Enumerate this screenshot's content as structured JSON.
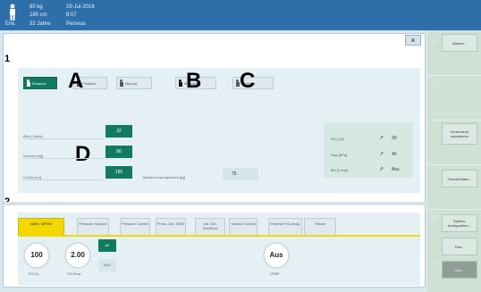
{
  "topbar": {
    "weight": "80 kg",
    "height": "185 cm",
    "category": "Erw.",
    "age": "32 Jahre",
    "date": "29-Jul-2016",
    "time": "8:07",
    "name": "Perseus"
  },
  "dialog": {
    "close_label": "×"
  },
  "section_numbers": [
    "1",
    "2"
  ],
  "annotations": {
    "A": "A",
    "B": "B",
    "C": "C",
    "D": "D"
  },
  "patient_types": [
    {
      "label": "Erwachs.",
      "active": true
    },
    {
      "label": "Pädiatrie",
      "active": false
    },
    {
      "label": "Neonat",
      "active": false
    },
    {
      "label": "Männlich",
      "active": false
    },
    {
      "label": "Weiblich",
      "active": false
    }
  ],
  "fields": {
    "age_label": "Alter [Jahre]",
    "age_value": "32",
    "weight_label": "Gewicht [kg]",
    "weight_value": "80",
    "height_label": "Größe [cm]",
    "height_value": "185",
    "ideal_label": "Ideales Körpergewicht [kg]",
    "ideal_value": "75"
  },
  "settings": [
    {
      "label": "FiO₂ [%]",
      "icon": "trend-up-icon",
      "value": "20"
    },
    {
      "label": "Paw [hPa]",
      "icon": "trend-up-icon",
      "value": "40"
    },
    {
      "label": "MV [L/min]",
      "icon": "trend-up-icon",
      "value": "Aus"
    }
  ],
  "mode_tabs": [
    {
      "label": "MAN / SPON",
      "active": true
    },
    {
      "label": "Pressure Support",
      "active": false
    },
    {
      "label": "Pressure Control",
      "active": false
    },
    {
      "label": "Press. Ctrl. SIMV",
      "active": false
    },
    {
      "label": "Vol. Ctrl. AutoFlow",
      "active": false
    },
    {
      "label": "Volume Control",
      "active": false
    },
    {
      "label": "Externer FG-Ausg.",
      "active": false
    },
    {
      "label": "Pause",
      "active": false
    }
  ],
  "controls": {
    "o2_value": "100",
    "o2_label": "FG-O₂",
    "flow_value": "2.00",
    "flow_label": "FG-Flow",
    "air_label": "Air",
    "n2o_label": "N₂O",
    "cpap_value": "Aus",
    "cpap_label": "CPAP"
  },
  "sidebar": {
    "alarme": "Alarme...",
    "screenshot": "Screenshot exportieren",
    "trends": "Trends/Daten...",
    "systemkonfig": "System-konfiguration...",
    "test": "Test...",
    "start": "Start..."
  },
  "colors": {
    "topbar": "#2e6faa",
    "accent_green": "#127a5e",
    "tab_active": "#f2d700",
    "sidebar": "#cfe0d4"
  }
}
